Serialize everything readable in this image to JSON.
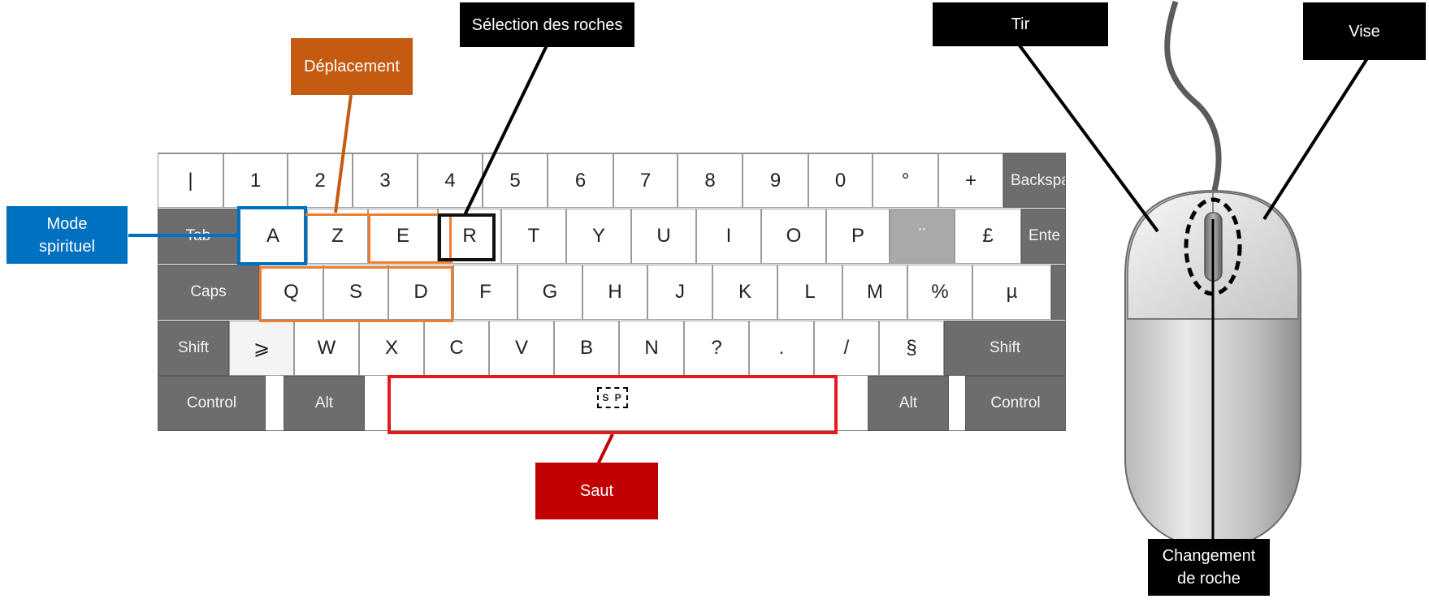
{
  "keyboard": {
    "row1": [
      "|",
      "1",
      "2",
      "3",
      "4",
      "5",
      "6",
      "7",
      "8",
      "9",
      "0",
      "°",
      "+",
      "Backspa"
    ],
    "row2": [
      "Tab",
      "A",
      "Z",
      "E",
      "R",
      "T",
      "Y",
      "U",
      "I",
      "O",
      "P",
      "¨",
      "£",
      "Ente"
    ],
    "row3": [
      "Caps",
      "Q",
      "S",
      "D",
      "F",
      "G",
      "H",
      "J",
      "K",
      "L",
      "M",
      "%",
      "µ"
    ],
    "row4": [
      "Shift",
      "⩾",
      "W",
      "X",
      "C",
      "V",
      "B",
      "N",
      "?",
      ".",
      "/",
      "§",
      "Shift"
    ],
    "row5": [
      "Control",
      "Alt",
      "S P",
      "Alt",
      "Control"
    ]
  },
  "labels": {
    "mode_spirituel": "Mode spirituel",
    "deplacement": "Déplacement",
    "selection_roches": "Sélection des roches",
    "saut": "Saut",
    "tir": "Tir",
    "vise": "Vise",
    "changement_roche": "Changement de roche"
  },
  "colors": {
    "mode_spirituel": "#0070C0",
    "deplacement": "#C55A11",
    "selection_roches": "#000000",
    "saut": "#C00000",
    "tir": "#000000",
    "vise": "#000000",
    "changement_roche": "#000000"
  }
}
